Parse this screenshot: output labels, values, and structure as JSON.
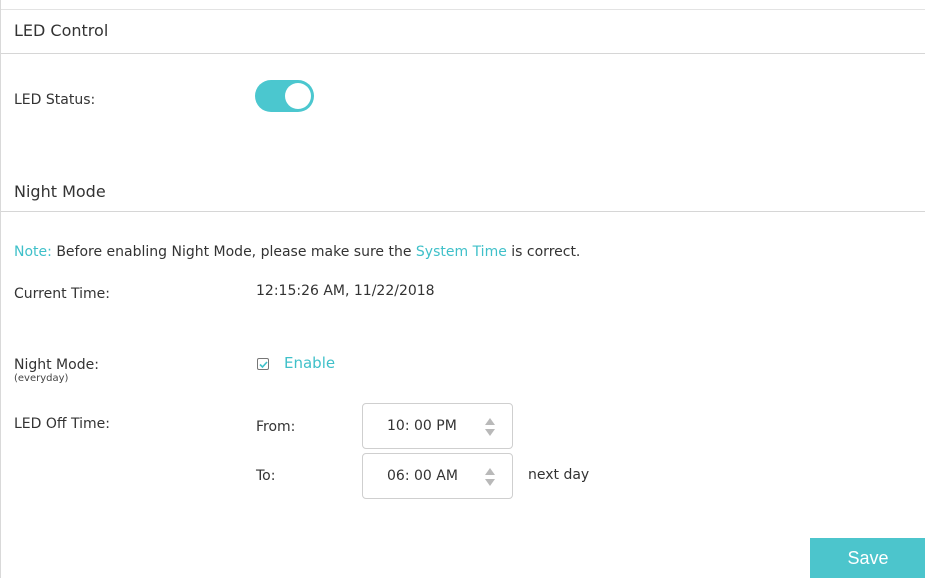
{
  "led_control": {
    "title": "LED Control",
    "status_label": "LED Status:",
    "led_on": true
  },
  "night_mode": {
    "title": "Night Mode",
    "note": {
      "prefix": "Note:",
      "text_before": "Before enabling Night Mode, please make sure the",
      "link": "System Time",
      "text_after": "is correct."
    },
    "current_time_label": "Current Time:",
    "current_time_value": "12:15:26 AM, 11/22/2018",
    "night_mode_label": "Night Mode:",
    "night_mode_sublabel": "(everyday)",
    "enable_label": "Enable",
    "enabled": true,
    "led_off_label": "LED Off Time:",
    "from_label": "From:",
    "from_value": "10: 00 PM",
    "to_label": "To:",
    "to_value": "06: 00 AM",
    "next_day_label": "next day"
  },
  "actions": {
    "save_label": "Save"
  },
  "colors": {
    "accent": "#4bc7cf",
    "link": "#3fc0c9"
  }
}
